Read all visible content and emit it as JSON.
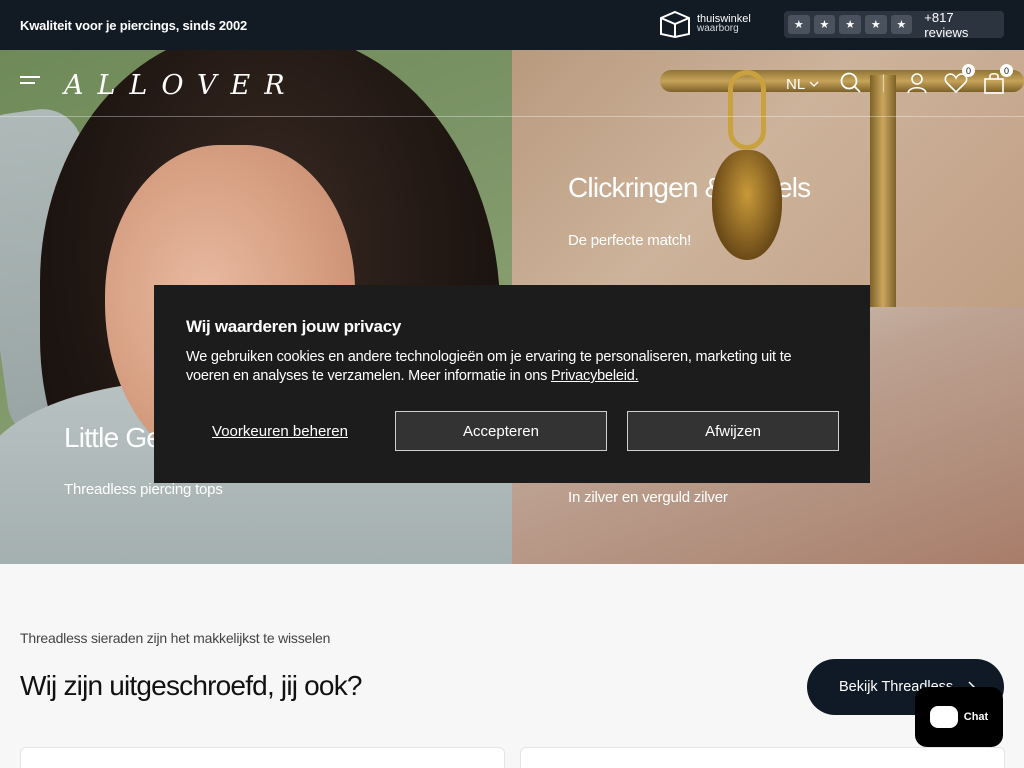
{
  "topbar": {
    "tagline": "Kwaliteit voor je piercings, sinds 2002",
    "trustmark_line1": "thuiswinkel",
    "trustmark_line2": "waarborg",
    "reviews_count": "+817 reviews",
    "stars": 5
  },
  "header": {
    "logo": "ALLOVER",
    "language": "NL",
    "wishlist_count": "0",
    "cart_count": "0"
  },
  "hero": {
    "left": {
      "title": "Little Ge",
      "subtitle": "Threadless piercing tops"
    },
    "top_right": {
      "title": "Clickringen & Bedels",
      "subtitle": "De perfecte match!"
    },
    "bottom_right": {
      "subtitle": "In zilver en verguld zilver"
    }
  },
  "cookie": {
    "title": "Wij waarderen jouw privacy",
    "body": "We gebruiken cookies en andere technologieën om je ervaring te personaliseren, marketing uit te voeren en analyses te verzamelen. Meer informatie in ons ",
    "link": "Privacybeleid.",
    "manage": "Voorkeuren beheren",
    "accept": "Accepteren",
    "reject": "Afwijzen"
  },
  "section": {
    "kicker": "Threadless sieraden zijn het makkelijkst te wisselen",
    "title": "Wij zijn uitgeschroefd, jij ook?",
    "cta": "Bekijk Threadless"
  },
  "chat": {
    "label": "Chat"
  }
}
